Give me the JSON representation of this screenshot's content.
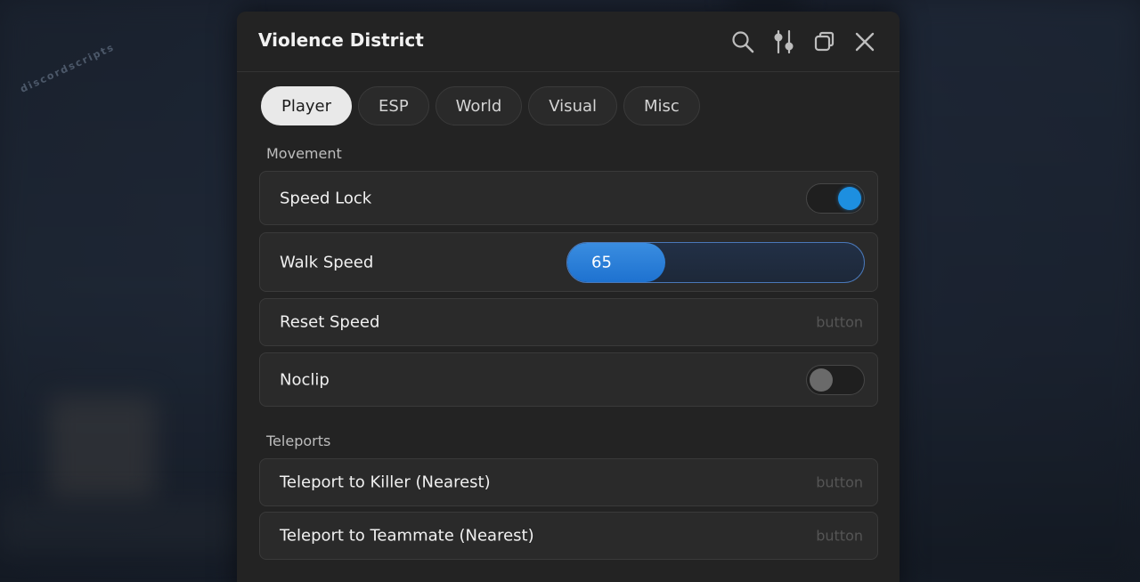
{
  "window": {
    "title": "Violence District",
    "icons": [
      "search-icon",
      "settings-sliders-icon",
      "duplicate-icon",
      "close-icon"
    ]
  },
  "background": {
    "watermark": "discordscripts"
  },
  "tabs": [
    {
      "label": "Player",
      "active": true
    },
    {
      "label": "ESP",
      "active": false
    },
    {
      "label": "World",
      "active": false
    },
    {
      "label": "Visual",
      "active": false
    },
    {
      "label": "Misc",
      "active": false
    }
  ],
  "sections": {
    "movement": {
      "label": "Movement",
      "speed_lock": {
        "label": "Speed Lock",
        "enabled": true
      },
      "walk_speed": {
        "label": "Walk Speed",
        "value": "65",
        "fill_fraction": 0.33
      },
      "reset_speed": {
        "label": "Reset Speed",
        "hint": "button"
      },
      "noclip": {
        "label": "Noclip",
        "enabled": false
      }
    },
    "teleports": {
      "label": "Teleports",
      "killer": {
        "label": "Teleport to Killer (Nearest)",
        "hint": "button"
      },
      "teammate": {
        "label": "Teleport to Teammate (Nearest)",
        "hint": "button"
      }
    }
  },
  "colors": {
    "accent": "#1d8fe0",
    "panel": "#232323",
    "row": "#2a2a2a"
  }
}
